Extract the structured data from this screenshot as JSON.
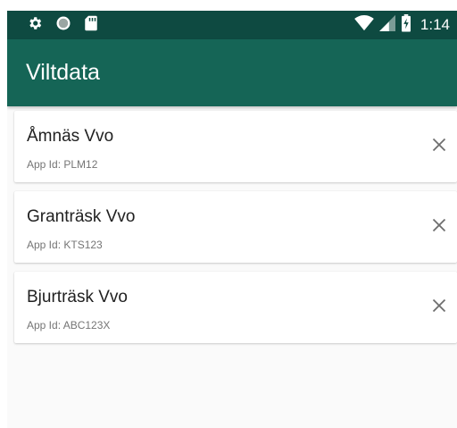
{
  "status_bar": {
    "time": "1:14",
    "icons": [
      "settings-icon",
      "circle-icon",
      "sd-card-icon",
      "wifi-icon",
      "signal-icon",
      "battery-charging-icon"
    ]
  },
  "app_bar": {
    "title": "Viltdata"
  },
  "items": [
    {
      "name": "Åmnäs Vvo",
      "app_id": "App Id: PLM12"
    },
    {
      "name": "Granträsk Vvo",
      "app_id": "App Id: KTS123"
    },
    {
      "name": "Bjurträsk Vvo",
      "app_id": "App Id: ABC123X"
    }
  ],
  "colors": {
    "status_bar": "#0e4a41",
    "app_bar": "#156556",
    "background": "#fafafa"
  }
}
